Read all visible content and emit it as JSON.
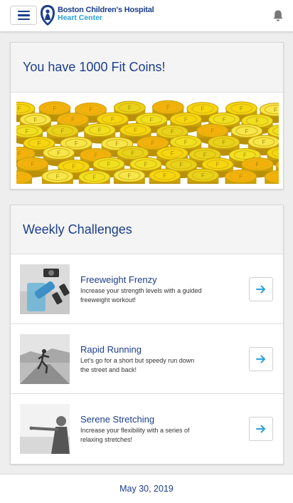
{
  "header": {
    "brand_name": "Boston Children's Hospital",
    "brand_sub": "Heart Center",
    "menu_icon": "hamburger-menu-icon",
    "notification_icon": "bell-icon"
  },
  "coins": {
    "title": "You have 1000 Fit Coins!",
    "coin_letter": "F"
  },
  "challenges": {
    "title": "Weekly Challenges",
    "items": [
      {
        "title": "Freeweight Frenzy",
        "description": "Increase your strength levels with a guided freeweight workout!"
      },
      {
        "title": "Rapid Running",
        "description": "Let's go for a short but speedy run down the street and back!"
      },
      {
        "title": "Serene Stretching",
        "description": "Increase your flexibility with a series of relaxing stretches!"
      }
    ]
  },
  "footer": {
    "date": "May 30, 2019"
  },
  "colors": {
    "primary": "#1b3e8c",
    "accent": "#2aa0dc",
    "coin": "#f2d21a"
  }
}
